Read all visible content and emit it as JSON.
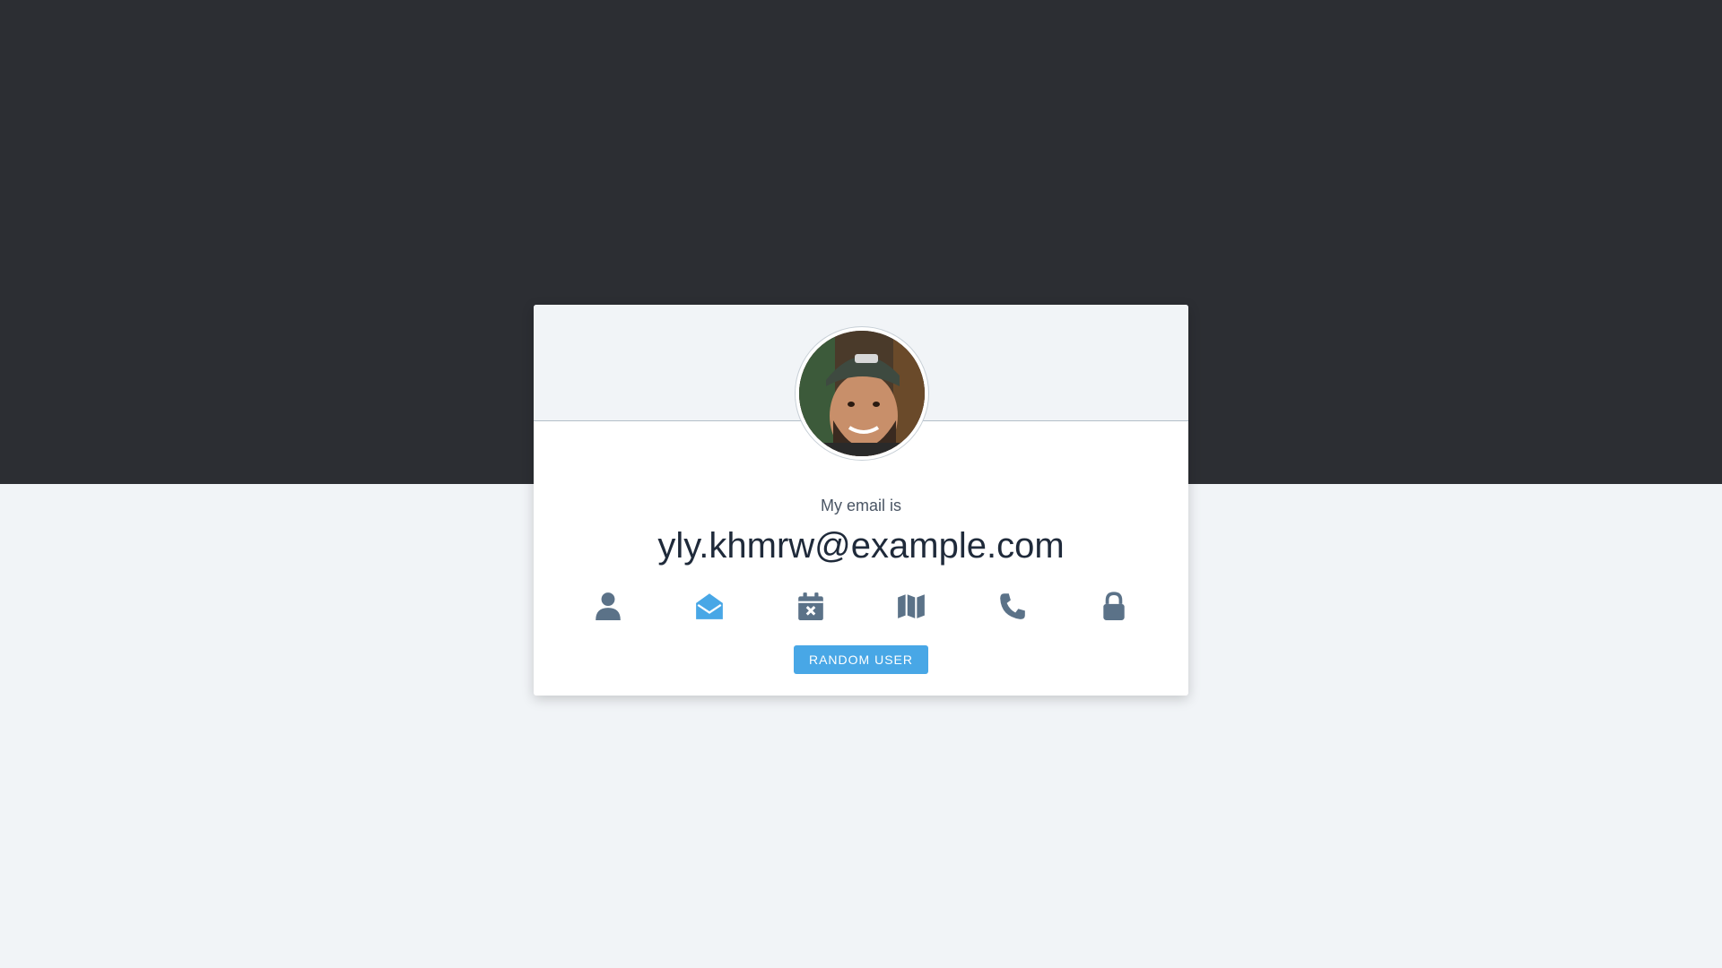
{
  "profile": {
    "email_label": "My email is",
    "email_value": "yly.khmrw@example.com"
  },
  "icons": [
    {
      "name": "user-icon",
      "active": false
    },
    {
      "name": "envelope-open-icon",
      "active": true
    },
    {
      "name": "calendar-x-icon",
      "active": false
    },
    {
      "name": "map-icon",
      "active": false
    },
    {
      "name": "phone-icon",
      "active": false
    },
    {
      "name": "lock-icon",
      "active": false
    }
  ],
  "colors": {
    "icon_default": "#5b7288",
    "icon_active": "#48a7e6",
    "button_bg": "#48a7e6",
    "top_band": "#2c2e33",
    "page_bg": "#f1f4f7"
  },
  "actions": {
    "random_user_label": "RANDOM USER"
  }
}
